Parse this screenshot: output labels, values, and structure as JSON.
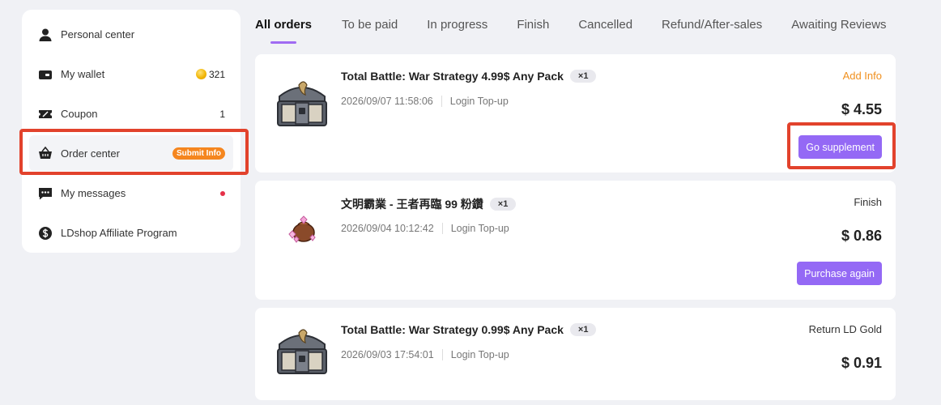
{
  "sidebar": {
    "items": [
      {
        "label": "Personal center",
        "icon": "user-icon"
      },
      {
        "label": "My wallet",
        "icon": "wallet-icon",
        "value": "321",
        "value_icon": "coin-icon"
      },
      {
        "label": "Coupon",
        "icon": "coupon-icon",
        "value": "1"
      },
      {
        "label": "Order center",
        "icon": "basket-icon",
        "badge": "Submit Info",
        "active": true
      },
      {
        "label": "My messages",
        "icon": "chat-icon",
        "dot": true
      },
      {
        "label": "LDshop Affiliate Program",
        "icon": "dollar-icon"
      }
    ]
  },
  "tabs": [
    {
      "label": "All orders",
      "active": true
    },
    {
      "label": "To be paid"
    },
    {
      "label": "In progress"
    },
    {
      "label": "Finish"
    },
    {
      "label": "Cancelled"
    },
    {
      "label": "Refund/After-sales"
    },
    {
      "label": "Awaiting Reviews"
    }
  ],
  "orders": [
    {
      "title": "Total Battle: War Strategy 4.99$ Any Pack",
      "qty": "×1",
      "date": "2026/09/07 11:58:06",
      "method": "Login Top-up",
      "status": "Add Info",
      "price": "$ 4.55",
      "button": "Go supplement",
      "thumb": "treasure-chest-icon"
    },
    {
      "title": "文明霸業 - 王者再臨 99 粉鑽",
      "qty": "×1",
      "date": "2026/09/04 10:12:42",
      "method": "Login Top-up",
      "status": "Finish",
      "price": "$ 0.86",
      "button": "Purchase again",
      "thumb": "diamond-bag-icon"
    },
    {
      "title": "Total Battle: War Strategy 0.99$ Any Pack",
      "qty": "×1",
      "date": "2026/09/03 17:54:01",
      "method": "Login Top-up",
      "status": "Return LD Gold",
      "price": "$ 0.91",
      "thumb": "treasure-chest-icon"
    }
  ],
  "colors": {
    "accent": "#9469f5",
    "tab_underline": "#a06bf2",
    "badge_orange": "#f5861f",
    "status_orange": "#f0901e",
    "highlight_red": "#e2422c",
    "dot_red": "#e53048",
    "background": "#f0f1f5"
  }
}
